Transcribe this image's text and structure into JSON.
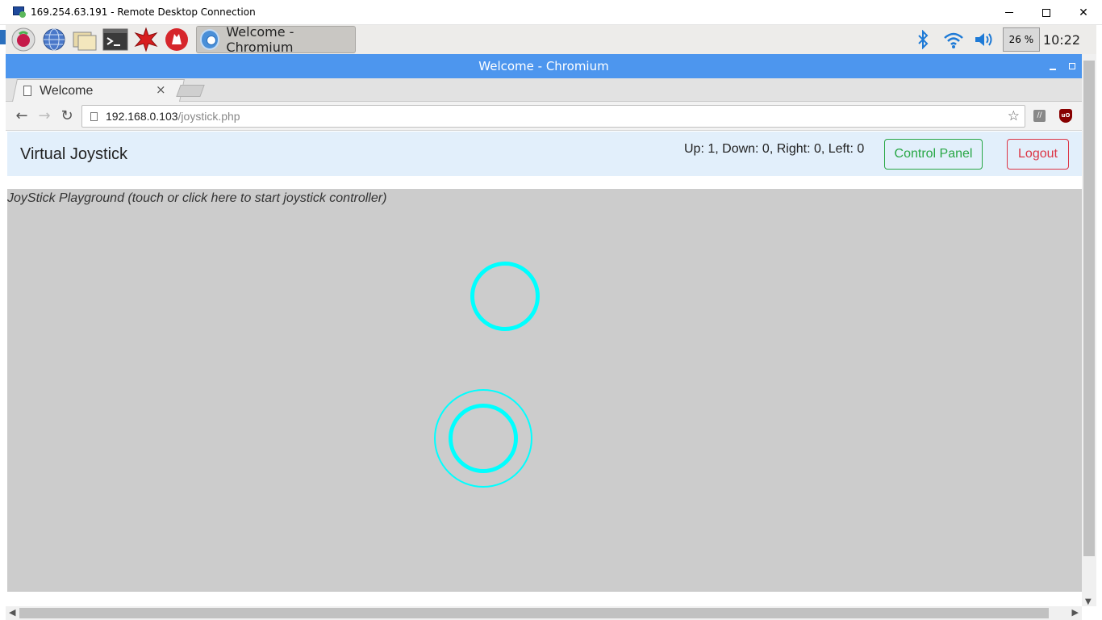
{
  "rdp": {
    "title": "169.254.63.191 - Remote Desktop Connection"
  },
  "taskbar": {
    "launchers": [
      "raspberry-menu-icon",
      "web-browser-icon",
      "file-manager-icon",
      "terminal-icon",
      "mathematica-icon",
      "wolfram-icon"
    ],
    "active_task": "Welcome - Chromium",
    "cpu_percent": "26 %",
    "clock": "10:22"
  },
  "browser": {
    "window_title": "Welcome - Chromium",
    "tab_title": "Welcome",
    "url_host": "192.168.0.103",
    "url_path": "/joystick.php"
  },
  "page": {
    "brand": "Virtual Joystick",
    "status": "Up: 1, Down: 0, Right: 0, Left: 0",
    "control_panel_label": "Control Panel",
    "logout_label": "Logout",
    "playground_text": "JoyStick Playground (touch or click here to start joystick controller)"
  },
  "colors": {
    "accent": "#4d96ee",
    "joystick": "#00ffff",
    "success": "#28a745",
    "danger": "#dc3545"
  }
}
